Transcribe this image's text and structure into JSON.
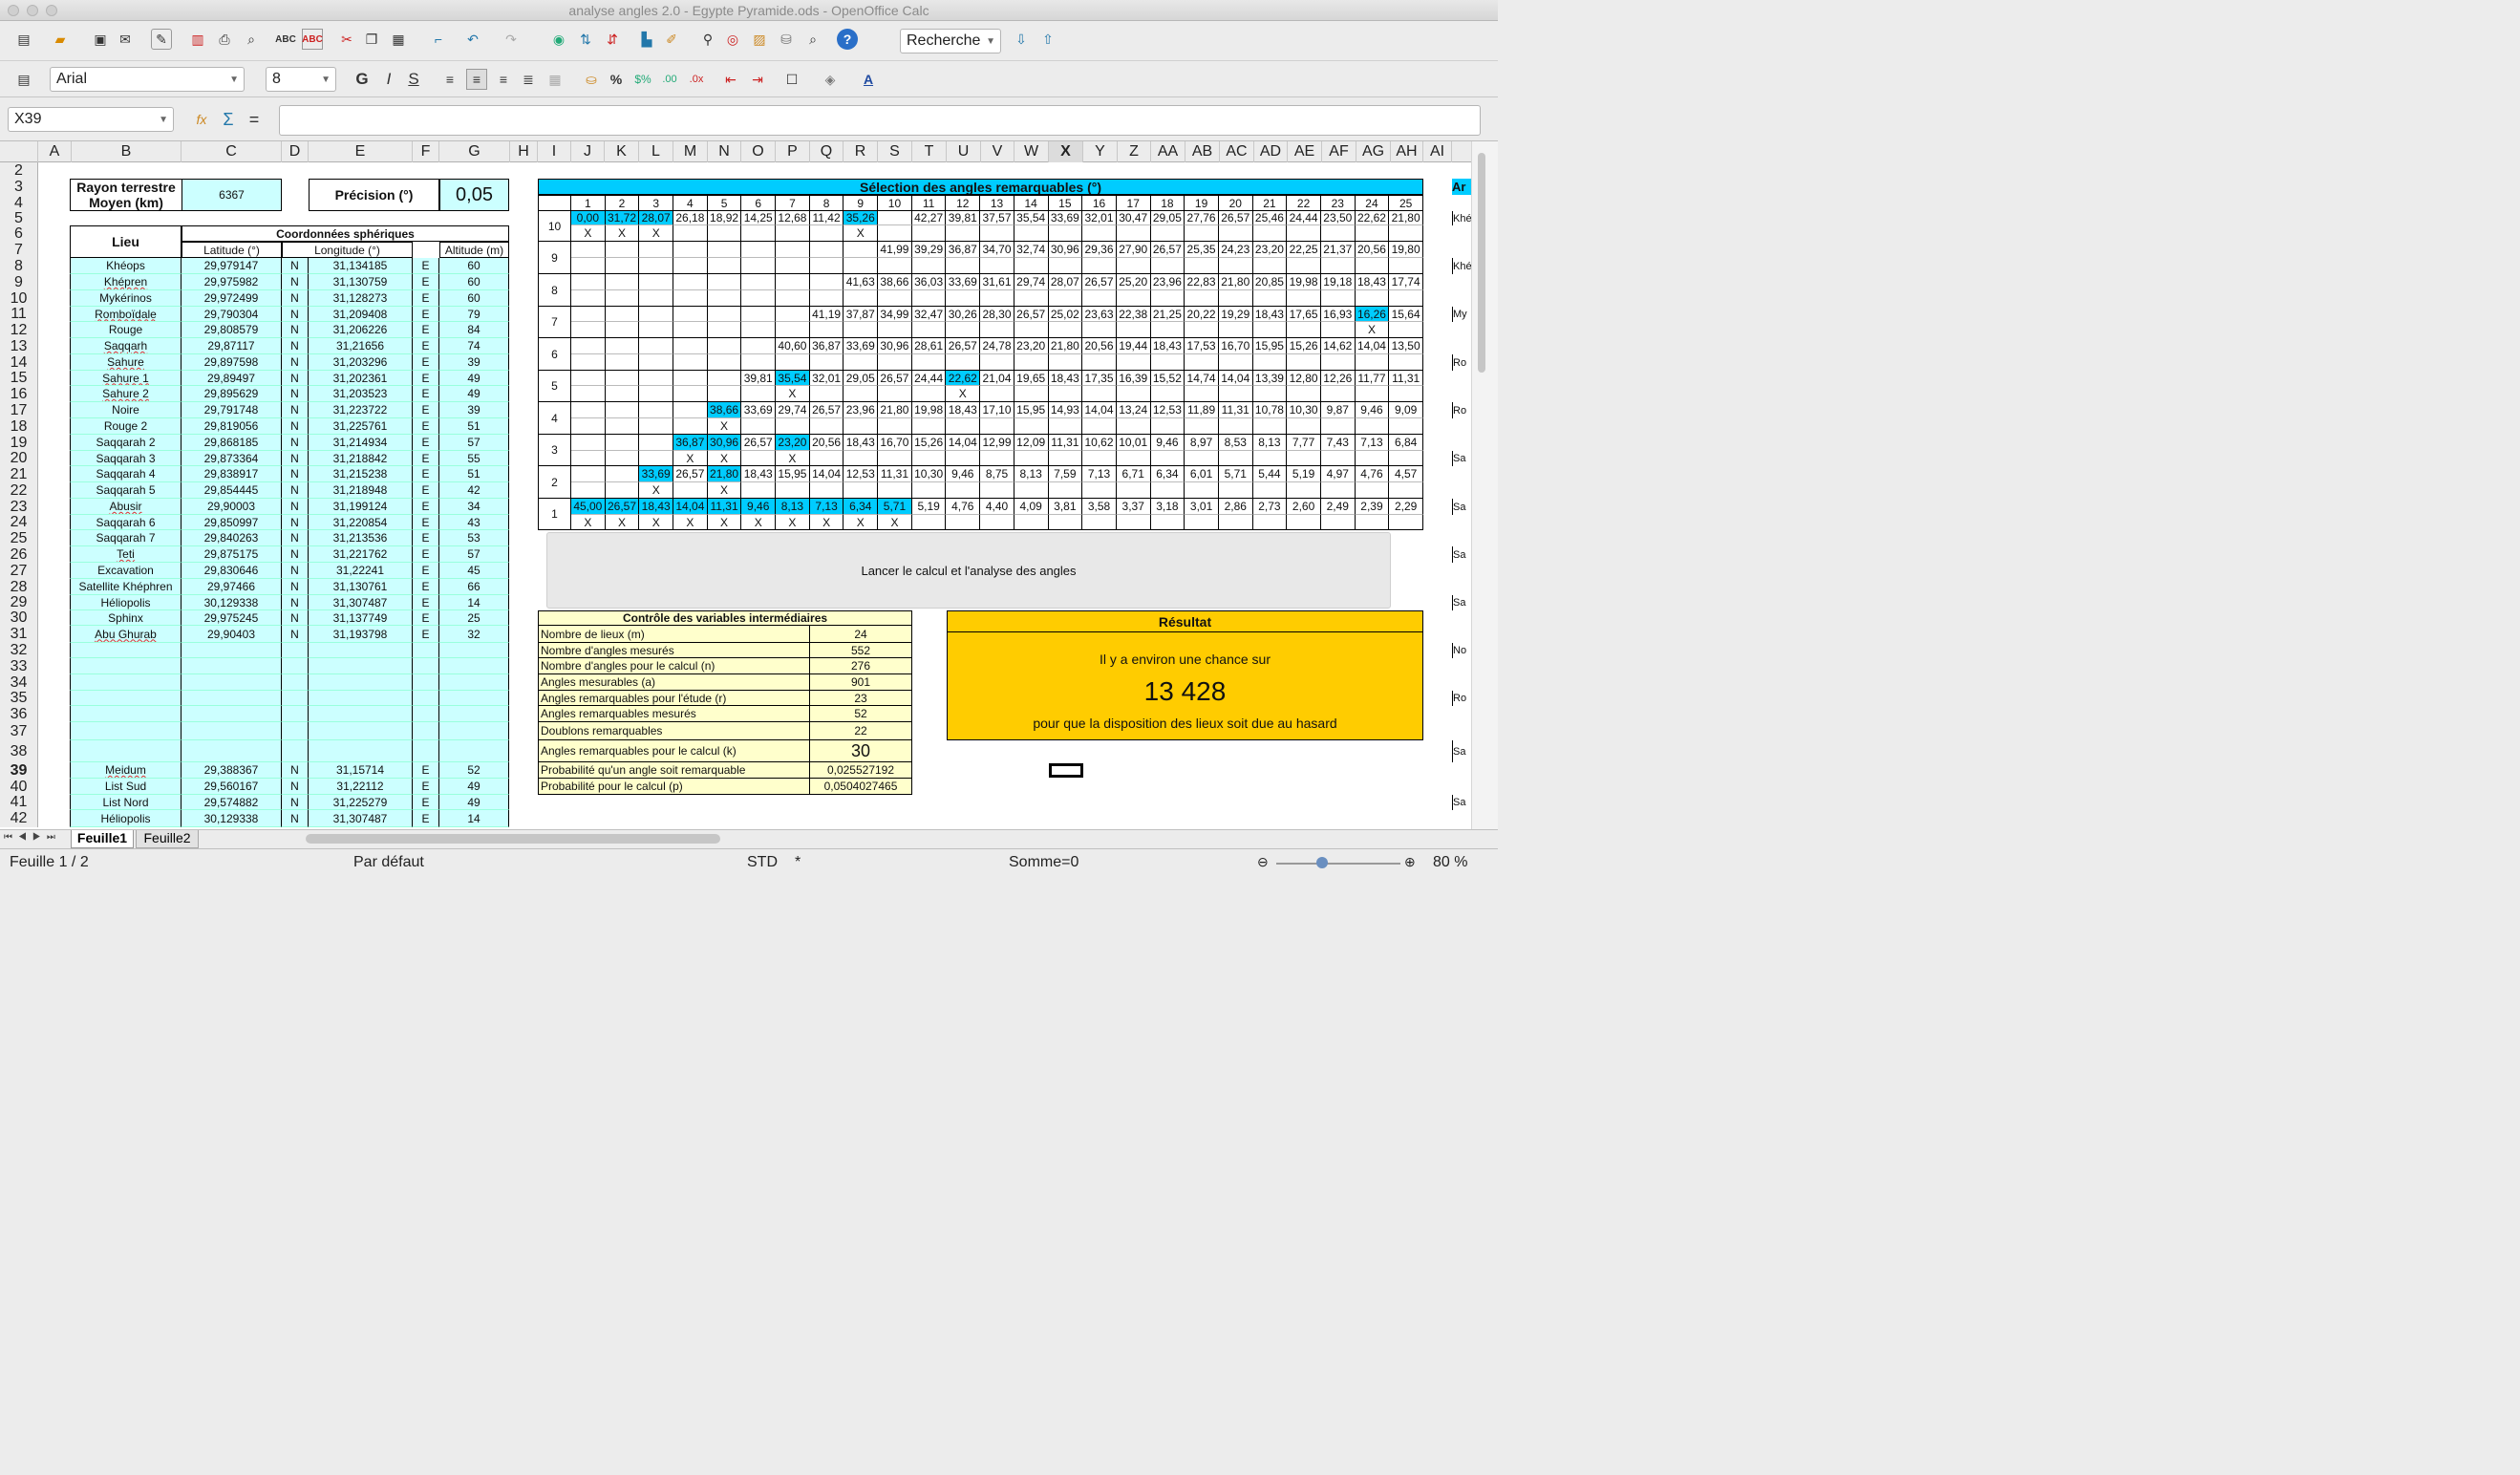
{
  "window": {
    "title": "analyse angles 2.0 - Egypte Pyramide.ods - OpenOffice Calc"
  },
  "toolbar": {
    "search_placeholder": "Recherche",
    "font_name": "Arial",
    "font_size": "8"
  },
  "formula_bar": {
    "cell_ref": "X39",
    "content": ""
  },
  "columns": [
    "A",
    "B",
    "C",
    "D",
    "E",
    "F",
    "G",
    "H",
    "I",
    "J",
    "K",
    "L",
    "M",
    "N",
    "O",
    "P",
    "Q",
    "R",
    "S",
    "T",
    "U",
    "V",
    "W",
    "X",
    "Y",
    "Z",
    "AA",
    "AB",
    "AC",
    "AD",
    "AE",
    "AF",
    "AG",
    "AH",
    "AI"
  ],
  "rows": [
    "2",
    "3",
    "4",
    "5",
    "6",
    "7",
    "8",
    "9",
    "10",
    "11",
    "12",
    "13",
    "14",
    "15",
    "16",
    "17",
    "18",
    "19",
    "20",
    "21",
    "22",
    "23",
    "24",
    "25",
    "26",
    "27",
    "28",
    "29",
    "30",
    "31",
    "32",
    "33",
    "34",
    "35",
    "36",
    "37",
    "38",
    "39",
    "40",
    "41",
    "42"
  ],
  "params": {
    "rayon_label": "Rayon terrestre Moyen (km)",
    "rayon_value": "6367",
    "precision_label": "Précision (°)",
    "precision_value": "0,05"
  },
  "locations": {
    "lieu_header": "Lieu",
    "coord_header": "Coordonnées sphériques",
    "lat_header": "Latitude (°)",
    "lon_header": "Longitude (°)",
    "alt_header": "Altitude (m)",
    "rows": [
      [
        "Khéops",
        "29,979147",
        "N",
        "31,134185",
        "E",
        "60"
      ],
      [
        "Khépren",
        "29,975982",
        "N",
        "31,130759",
        "E",
        "60"
      ],
      [
        "Mykérinos",
        "29,972499",
        "N",
        "31,128273",
        "E",
        "60"
      ],
      [
        "Romboïdale",
        "29,790304",
        "N",
        "31,209408",
        "E",
        "79"
      ],
      [
        "Rouge",
        "29,808579",
        "N",
        "31,206226",
        "E",
        "84"
      ],
      [
        "Saqqarh",
        "29,87117",
        "N",
        "31,21656",
        "E",
        "74"
      ],
      [
        "Sahure",
        "29,897598",
        "N",
        "31,203296",
        "E",
        "39"
      ],
      [
        "Sahure 1",
        "29,89497",
        "N",
        "31,202361",
        "E",
        "49"
      ],
      [
        "Sahure 2",
        "29,895629",
        "N",
        "31,203523",
        "E",
        "49"
      ],
      [
        "Noire",
        "29,791748",
        "N",
        "31,223722",
        "E",
        "39"
      ],
      [
        "Rouge 2",
        "29,819056",
        "N",
        "31,225761",
        "E",
        "51"
      ],
      [
        "Saqqarah 2",
        "29,868185",
        "N",
        "31,214934",
        "E",
        "57"
      ],
      [
        "Saqqarah 3",
        "29,873364",
        "N",
        "31,218842",
        "E",
        "55"
      ],
      [
        "Saqqarah 4",
        "29,838917",
        "N",
        "31,215238",
        "E",
        "51"
      ],
      [
        "Saqqarah 5",
        "29,854445",
        "N",
        "31,218948",
        "E",
        "42"
      ],
      [
        "Abusir",
        "29,90003",
        "N",
        "31,199124",
        "E",
        "34"
      ],
      [
        "Saqqarah 6",
        "29,850997",
        "N",
        "31,220854",
        "E",
        "43"
      ],
      [
        "Saqqarah 7",
        "29,840263",
        "N",
        "31,213536",
        "E",
        "53"
      ],
      [
        "Teti",
        "29,875175",
        "N",
        "31,221762",
        "E",
        "57"
      ],
      [
        "Excavation",
        "29,830646",
        "N",
        "31,22241",
        "E",
        "45"
      ],
      [
        "Satellite Khéphren",
        "29,97466",
        "N",
        "31,130761",
        "E",
        "66"
      ],
      [
        "Héliopolis",
        "30,129338",
        "N",
        "31,307487",
        "E",
        "14"
      ],
      [
        "Sphinx",
        "29,975245",
        "N",
        "31,137749",
        "E",
        "25"
      ],
      [
        "Abu Ghurab",
        "29,90403",
        "N",
        "31,193798",
        "E",
        "32"
      ]
    ],
    "rows_b": [
      [
        "Meidum",
        "29,388367",
        "N",
        "31,15714",
        "E",
        "52"
      ],
      [
        "List Sud",
        "29,560167",
        "N",
        "31,22112",
        "E",
        "49"
      ],
      [
        "List Nord",
        "29,574882",
        "N",
        "31,225279",
        "E",
        "49"
      ],
      [
        "Héliopolis",
        "30,129338",
        "N",
        "31,307487",
        "E",
        "14"
      ]
    ]
  },
  "angles": {
    "title": "Sélection des angles remarquables (°)",
    "cols": [
      "1",
      "2",
      "3",
      "4",
      "5",
      "6",
      "7",
      "8",
      "9",
      "10",
      "11",
      "12",
      "13",
      "14",
      "15",
      "16",
      "17",
      "18",
      "19",
      "20",
      "21",
      "22",
      "23",
      "24",
      "25"
    ],
    "levels": [
      "10",
      "9",
      "8",
      "7",
      "6",
      "5",
      "4",
      "3",
      "2",
      "1"
    ],
    "values": [
      [
        "0,00",
        "31,72",
        "28,07",
        "26,18",
        "18,92",
        "14,25",
        "12,68",
        "11,42",
        "35,26",
        "",
        "42,27",
        "39,81",
        "37,57",
        "35,54",
        "33,69",
        "32,01",
        "30,47",
        "29,05",
        "27,76",
        "26,57",
        "25,46",
        "24,44",
        "23,50",
        "22,62",
        "21,80"
      ],
      [
        "",
        "",
        "",
        "",
        "",
        "",
        "",
        "",
        "",
        "41,99",
        "39,29",
        "36,87",
        "34,70",
        "32,74",
        "30,96",
        "29,36",
        "27,90",
        "26,57",
        "25,35",
        "24,23",
        "23,20",
        "22,25",
        "21,37",
        "20,56",
        "19,80"
      ],
      [
        "",
        "",
        "",
        "",
        "",
        "",
        "",
        "",
        "41,63",
        "38,66",
        "36,03",
        "33,69",
        "31,61",
        "29,74",
        "28,07",
        "26,57",
        "25,20",
        "23,96",
        "22,83",
        "21,80",
        "20,85",
        "19,98",
        "19,18",
        "18,43",
        "17,74"
      ],
      [
        "",
        "",
        "",
        "",
        "",
        "",
        "",
        "41,19",
        "37,87",
        "34,99",
        "32,47",
        "30,26",
        "28,30",
        "26,57",
        "25,02",
        "23,63",
        "22,38",
        "21,25",
        "20,22",
        "19,29",
        "18,43",
        "17,65",
        "16,93",
        "16,26",
        "15,64"
      ],
      [
        "",
        "",
        "",
        "",
        "",
        "",
        "40,60",
        "36,87",
        "33,69",
        "30,96",
        "28,61",
        "26,57",
        "24,78",
        "23,20",
        "21,80",
        "20,56",
        "19,44",
        "18,43",
        "17,53",
        "16,70",
        "15,95",
        "15,26",
        "14,62",
        "14,04",
        "13,50"
      ],
      [
        "",
        "",
        "",
        "",
        "",
        "39,81",
        "35,54",
        "32,01",
        "29,05",
        "26,57",
        "24,44",
        "22,62",
        "21,04",
        "19,65",
        "18,43",
        "17,35",
        "16,39",
        "15,52",
        "14,74",
        "14,04",
        "13,39",
        "12,80",
        "12,26",
        "11,77",
        "11,31"
      ],
      [
        "",
        "",
        "",
        "",
        "38,66",
        "33,69",
        "29,74",
        "26,57",
        "23,96",
        "21,80",
        "19,98",
        "18,43",
        "17,10",
        "15,95",
        "14,93",
        "14,04",
        "13,24",
        "12,53",
        "11,89",
        "11,31",
        "10,78",
        "10,30",
        "9,87",
        "9,46",
        "9,09"
      ],
      [
        "",
        "",
        "",
        "36,87",
        "30,96",
        "26,57",
        "23,20",
        "20,56",
        "18,43",
        "16,70",
        "15,26",
        "14,04",
        "12,99",
        "12,09",
        "11,31",
        "10,62",
        "10,01",
        "9,46",
        "8,97",
        "8,53",
        "8,13",
        "7,77",
        "7,43",
        "7,13",
        "6,84"
      ],
      [
        "",
        "",
        "33,69",
        "26,57",
        "21,80",
        "18,43",
        "15,95",
        "14,04",
        "12,53",
        "11,31",
        "10,30",
        "9,46",
        "8,75",
        "8,13",
        "7,59",
        "7,13",
        "6,71",
        "6,34",
        "6,01",
        "5,71",
        "5,44",
        "5,19",
        "4,97",
        "4,76",
        "4,57"
      ],
      [
        "45,00",
        "26,57",
        "18,43",
        "14,04",
        "11,31",
        "9,46",
        "8,13",
        "7,13",
        "6,34",
        "5,71",
        "5,19",
        "4,76",
        "4,40",
        "4,09",
        "3,81",
        "3,58",
        "3,37",
        "3,18",
        "3,01",
        "2,86",
        "2,73",
        "2,60",
        "2,49",
        "2,39",
        "2,29"
      ]
    ],
    "highlight": [
      [
        0,
        1,
        2,
        8
      ],
      [],
      [],
      [
        23
      ],
      [],
      [
        6,
        11
      ],
      [
        4
      ],
      [
        3,
        4,
        6
      ],
      [
        2,
        4
      ],
      [
        0,
        1,
        2,
        3,
        4,
        5,
        6,
        7,
        8,
        9
      ]
    ],
    "marks": [
      [
        0,
        1,
        2,
        8
      ],
      [],
      [],
      [
        23
      ],
      [],
      [
        6,
        11
      ],
      [
        4
      ],
      [
        3,
        4,
        6
      ],
      [
        2,
        4
      ],
      [
        0,
        1,
        2,
        3,
        4,
        5,
        6,
        7,
        8,
        9
      ]
    ],
    "mark_label": "X"
  },
  "button": {
    "label": "Lancer le calcul et l'analyse des angles"
  },
  "control": {
    "title": "Contrôle des variables intermédiaires",
    "rows": [
      [
        "Nombre de lieux (m)",
        "24"
      ],
      [
        "Nombre d'angles mesurés",
        "552"
      ],
      [
        "Nombre d'angles pour le calcul (n)",
        "276"
      ],
      [
        "Angles mesurables (a)",
        "901"
      ],
      [
        "Angles remarquables pour l'étude (r)",
        "23"
      ],
      [
        "Angles remarquables mesurés",
        "52"
      ],
      [
        "Doublons remarquables",
        "22"
      ],
      [
        "Angles remarquables pour le calcul (k)",
        "30"
      ],
      [
        "Probabilité qu'un angle soit remarquable",
        "0,025527192"
      ],
      [
        "Probabilité pour le calcul (p)",
        "0,0504027465"
      ]
    ]
  },
  "result": {
    "title": "Résultat",
    "line1": "Il y a environ une chance sur",
    "value": "13 428",
    "line2": "pour que la disposition des lieux soit due au hasard"
  },
  "right_edge": {
    "header": "Ar",
    "labels": [
      [
        "5",
        "Khé"
      ],
      [
        "8",
        "Khé"
      ],
      [
        "11",
        "My"
      ],
      [
        "14",
        "Ro"
      ],
      [
        "17",
        "Ro"
      ],
      [
        "20",
        "Sa"
      ],
      [
        "23",
        "Sa"
      ],
      [
        "26",
        "Sa"
      ],
      [
        "29",
        "Sa"
      ],
      [
        "32",
        "No"
      ],
      [
        "35",
        "Ro"
      ],
      [
        "38",
        "Sa"
      ],
      [
        "41",
        "Sa"
      ]
    ]
  },
  "sheets": {
    "tabs": [
      "Feuille1",
      "Feuille2"
    ],
    "active": "Feuille1"
  },
  "status": {
    "sheet": "Feuille 1 / 2",
    "style": "Par défaut",
    "mode": "STD",
    "modified": "*",
    "sum": "Somme=0",
    "zoom": "80 %"
  },
  "colors": {
    "cyan": "#ccffff",
    "selected": "#00ccff",
    "header_bar": "#00ccff",
    "result": "#ffcc00",
    "control": "#ffffcc"
  }
}
